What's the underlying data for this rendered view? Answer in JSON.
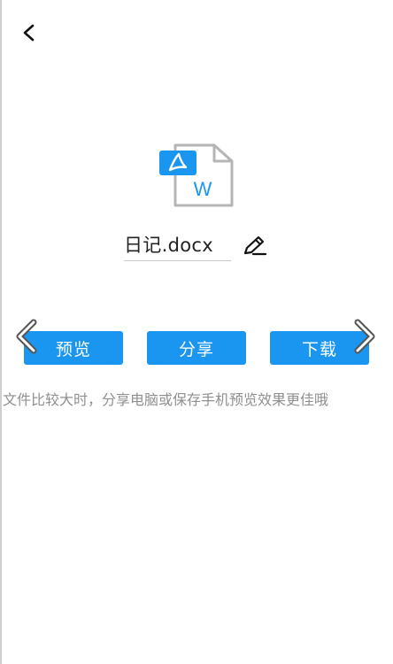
{
  "header": {
    "back_icon": "chevron-left-icon"
  },
  "file": {
    "icon": "word-document-icon",
    "badge_icon": "pdf-acrobat-badge-icon",
    "letter": "W",
    "name": "日记.docx",
    "edit_icon": "pencil-icon"
  },
  "actions": {
    "preview_label": "预览",
    "share_label": "分享",
    "download_label": "下载"
  },
  "tip": "文件比较大时，分享电脑或保存手机预览效果更佳哦",
  "colors": {
    "accent": "#1a95f0",
    "text": "#222222",
    "tip": "#8f8f8f"
  },
  "nav": {
    "prev_icon": "chevron-left-icon",
    "next_icon": "chevron-right-icon"
  }
}
